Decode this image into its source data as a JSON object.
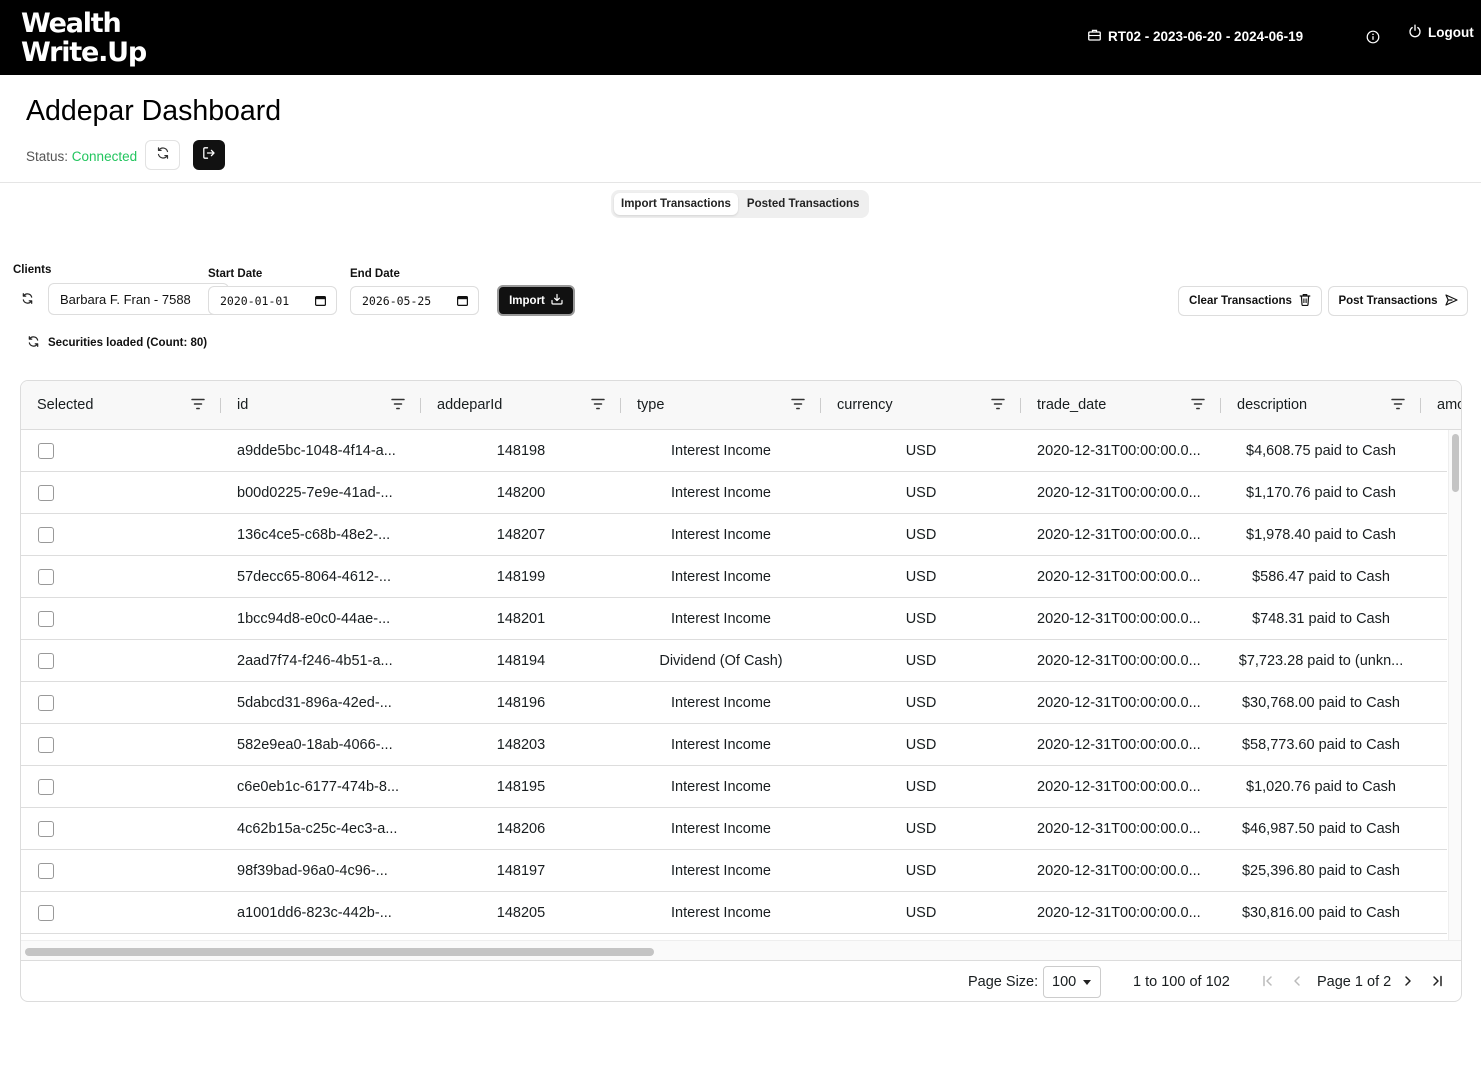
{
  "header": {
    "logo_line1": "Wealth",
    "logo_line2": "Write.Up",
    "period": "RT02 - 2023-06-20 - 2024-06-19",
    "logout_label": "Logout"
  },
  "page": {
    "title": "Addepar Dashboard",
    "status_label": "Status:",
    "status_value": "Connected",
    "status_color": "#22c55e"
  },
  "tabs": [
    {
      "label": "Import Transactions",
      "active": true
    },
    {
      "label": "Posted Transactions",
      "active": false
    }
  ],
  "filters": {
    "clients_label": "Clients",
    "client_value": "Barbara F. Fran - 7588",
    "start_label": "Start Date",
    "start_value": "2020-01-01",
    "end_label": "End Date",
    "end_value": "2026-05-25",
    "import_label": "Import",
    "clear_label": "Clear Transactions",
    "post_label": "Post Transactions"
  },
  "securities_loaded": "Securities loaded (Count: 80)",
  "grid": {
    "columns": [
      "Selected",
      "id",
      "addeparId",
      "type",
      "currency",
      "trade_date",
      "description",
      "amo"
    ],
    "rows": [
      {
        "id": "a9dde5bc-1048-4f14-a...",
        "addeparId": "148198",
        "type": "Interest Income",
        "currency": "USD",
        "trade_date": "2020-12-31T00:00:00.0...",
        "description": "$4,608.75 paid to Cash"
      },
      {
        "id": "b00d0225-7e9e-41ad-...",
        "addeparId": "148200",
        "type": "Interest Income",
        "currency": "USD",
        "trade_date": "2020-12-31T00:00:00.0...",
        "description": "$1,170.76 paid to Cash"
      },
      {
        "id": "136c4ce5-c68b-48e2-...",
        "addeparId": "148207",
        "type": "Interest Income",
        "currency": "USD",
        "trade_date": "2020-12-31T00:00:00.0...",
        "description": "$1,978.40 paid to Cash"
      },
      {
        "id": "57decc65-8064-4612-...",
        "addeparId": "148199",
        "type": "Interest Income",
        "currency": "USD",
        "trade_date": "2020-12-31T00:00:00.0...",
        "description": "$586.47 paid to Cash"
      },
      {
        "id": "1bcc94d8-e0c0-44ae-...",
        "addeparId": "148201",
        "type": "Interest Income",
        "currency": "USD",
        "trade_date": "2020-12-31T00:00:00.0...",
        "description": "$748.31 paid to Cash"
      },
      {
        "id": "2aad7f74-f246-4b51-a...",
        "addeparId": "148194",
        "type": "Dividend (Of Cash)",
        "currency": "USD",
        "trade_date": "2020-12-31T00:00:00.0...",
        "description": "$7,723.28 paid to (unkn..."
      },
      {
        "id": "5dabcd31-896a-42ed-...",
        "addeparId": "148196",
        "type": "Interest Income",
        "currency": "USD",
        "trade_date": "2020-12-31T00:00:00.0...",
        "description": "$30,768.00 paid to Cash"
      },
      {
        "id": "582e9ea0-18ab-4066-...",
        "addeparId": "148203",
        "type": "Interest Income",
        "currency": "USD",
        "trade_date": "2020-12-31T00:00:00.0...",
        "description": "$58,773.60 paid to Cash"
      },
      {
        "id": "c6e0eb1c-6177-474b-8...",
        "addeparId": "148195",
        "type": "Interest Income",
        "currency": "USD",
        "trade_date": "2020-12-31T00:00:00.0...",
        "description": "$1,020.76 paid to Cash"
      },
      {
        "id": "4c62b15a-c25c-4ec3-a...",
        "addeparId": "148206",
        "type": "Interest Income",
        "currency": "USD",
        "trade_date": "2020-12-31T00:00:00.0...",
        "description": "$46,987.50 paid to Cash"
      },
      {
        "id": "98f39bad-96a0-4c96-...",
        "addeparId": "148197",
        "type": "Interest Income",
        "currency": "USD",
        "trade_date": "2020-12-31T00:00:00.0...",
        "description": "$25,396.80 paid to Cash"
      },
      {
        "id": "a1001dd6-823c-442b-...",
        "addeparId": "148205",
        "type": "Interest Income",
        "currency": "USD",
        "trade_date": "2020-12-31T00:00:00.0...",
        "description": "$30,816.00 paid to Cash"
      }
    ]
  },
  "pagination": {
    "page_size_label": "Page Size:",
    "page_size_value": "100",
    "range_from": "1",
    "range_to_word": "to",
    "range_to": "100",
    "range_of_word": "of",
    "range_total": "102",
    "page_word": "Page",
    "page_current": "1",
    "page_of_word": "of",
    "page_total": "2"
  },
  "icons": {
    "briefcase": "briefcase-icon",
    "info": "info-icon",
    "power": "power-icon",
    "refresh": "refresh-icon",
    "exit": "exit-icon",
    "download": "download-icon",
    "trash": "trash-icon",
    "send": "send-icon",
    "filter": "filter-icon",
    "calendar": "calendar-icon"
  }
}
